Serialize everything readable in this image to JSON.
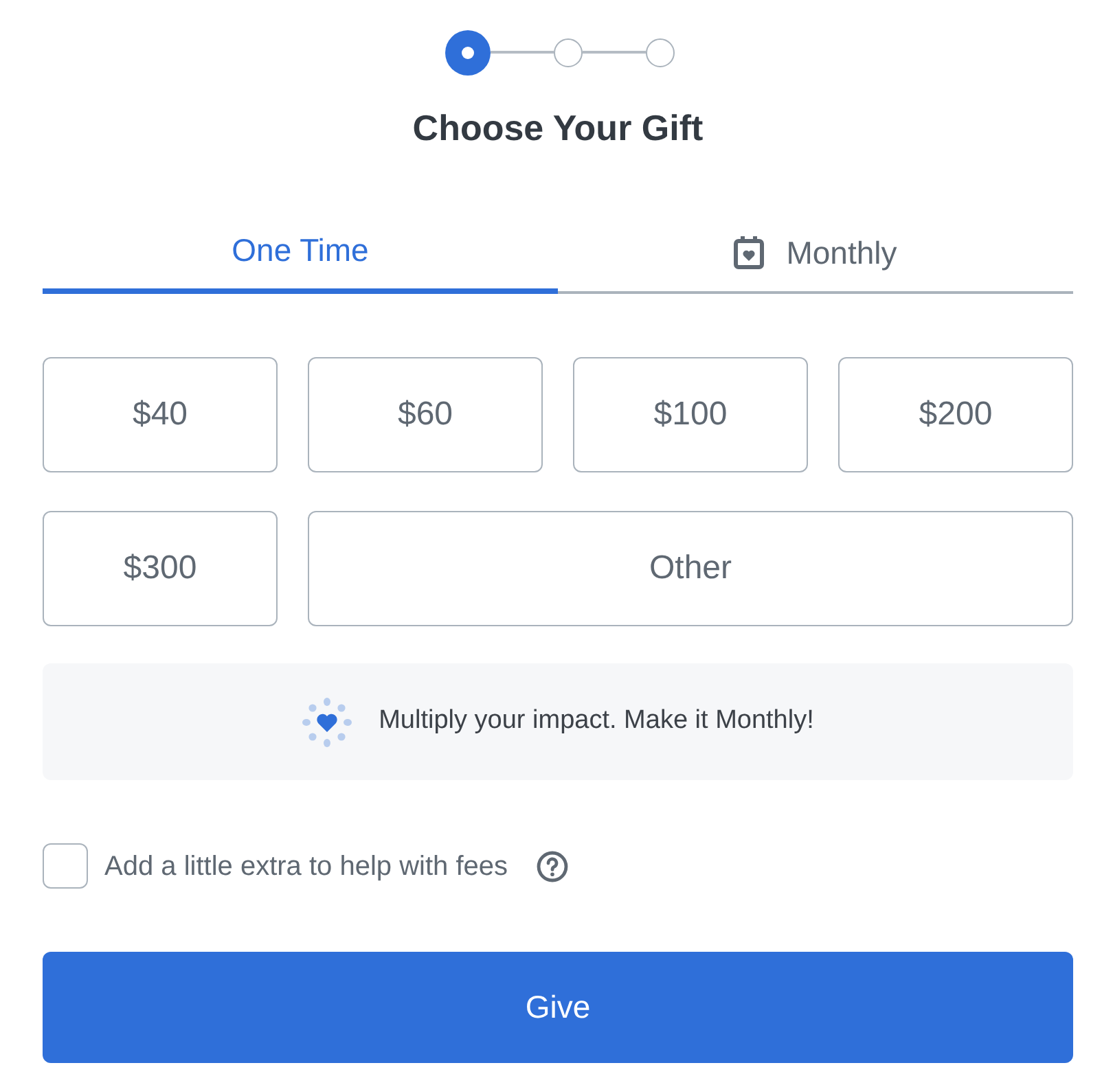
{
  "steps": [
    {
      "selected": true
    },
    {
      "selected": false
    },
    {
      "selected": false
    }
  ],
  "title": "Choose Your Gift",
  "tabs": [
    {
      "label": "One Time",
      "selected": true,
      "kind": "plain"
    },
    {
      "label": "Monthly",
      "selected": false,
      "kind": "calendar"
    }
  ],
  "amounts": [
    {
      "label": "$40",
      "selected": false
    },
    {
      "label": "$60",
      "selected": false
    },
    {
      "label": "$100",
      "selected": false
    },
    {
      "label": "$200",
      "selected": false
    },
    {
      "label": "$300",
      "selected": false
    },
    {
      "label": "Other",
      "selected": false
    }
  ],
  "banner": "Multiply your impact. Make it Monthly!",
  "fees": {
    "label": "Add a little extra to help with fees",
    "checked": false
  },
  "give_button": "Give"
}
